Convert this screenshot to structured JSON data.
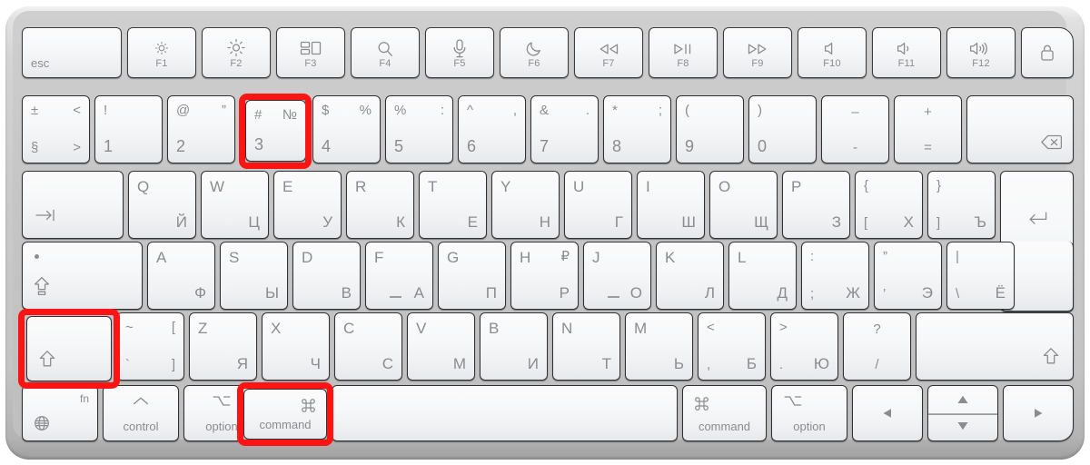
{
  "device": {
    "name": "Apple Magic Keyboard with Touch ID",
    "layout": "US / Russian (Cyrillic) dual-legend",
    "accent_highlight_color": "#ff1414",
    "body_color": "#c8c8c8",
    "key_color": "#f6f7f9",
    "legend_color": "#8a8c90"
  },
  "highlighted_keys": [
    "shift-left",
    "3",
    "command-left"
  ],
  "rows": {
    "function_row": [
      {
        "id": "esc",
        "label": "esc",
        "type": "word"
      },
      {
        "id": "f1",
        "fkey": "F1",
        "icon": "brightness-down-icon"
      },
      {
        "id": "f2",
        "fkey": "F2",
        "icon": "brightness-up-icon"
      },
      {
        "id": "f3",
        "fkey": "F3",
        "icon": "mission-control-icon"
      },
      {
        "id": "f4",
        "fkey": "F4",
        "icon": "spotlight-search-icon"
      },
      {
        "id": "f5",
        "fkey": "F5",
        "icon": "dictation-microphone-icon"
      },
      {
        "id": "f6",
        "fkey": "F6",
        "icon": "do-not-disturb-moon-icon"
      },
      {
        "id": "f7",
        "fkey": "F7",
        "icon": "rewind-icon"
      },
      {
        "id": "f8",
        "fkey": "F8",
        "icon": "play-pause-icon"
      },
      {
        "id": "f9",
        "fkey": "F9",
        "icon": "fast-forward-icon"
      },
      {
        "id": "f10",
        "fkey": "F10",
        "icon": "mute-icon"
      },
      {
        "id": "f11",
        "fkey": "F11",
        "icon": "volume-down-icon"
      },
      {
        "id": "f12",
        "fkey": "F12",
        "icon": "volume-up-icon"
      },
      {
        "id": "touchid",
        "icon": "touch-id-lock-icon"
      }
    ],
    "number_row": [
      {
        "id": "section",
        "top_left": "±",
        "top_right": "<",
        "bottom_left": "§",
        "bottom_right": ">"
      },
      {
        "id": "1",
        "top_left": "!",
        "bottom_left": "1"
      },
      {
        "id": "2",
        "top_left": "@",
        "top_right": "”",
        "bottom_left": "2"
      },
      {
        "id": "3",
        "top_left": "#",
        "top_right": "№",
        "bottom_left": "3",
        "highlighted": true
      },
      {
        "id": "4",
        "top_left": "$",
        "top_right": "%",
        "bottom_left": "4"
      },
      {
        "id": "5",
        "top_left": "%",
        "top_right": ":",
        "bottom_left": "5"
      },
      {
        "id": "6",
        "top_left": "^",
        "top_right": ",",
        "bottom_left": "6"
      },
      {
        "id": "7",
        "top_left": "&",
        "top_right": ".",
        "bottom_left": "7"
      },
      {
        "id": "8",
        "top_left": "*",
        "top_right": ";",
        "bottom_left": "8"
      },
      {
        "id": "9",
        "top_left": "(",
        "bottom_left": "9"
      },
      {
        "id": "0",
        "top_left": ")",
        "bottom_left": "0"
      },
      {
        "id": "minus",
        "top_left": "–",
        "bottom_left": "-"
      },
      {
        "id": "equal",
        "top_left": "+",
        "bottom_left": "="
      },
      {
        "id": "delete",
        "icon": "delete-backspace-icon"
      }
    ],
    "qwerty_row": [
      {
        "id": "tab",
        "icon": "tab-arrow-icon"
      },
      {
        "id": "q",
        "latin": "Q",
        "cyrillic": "Й"
      },
      {
        "id": "w",
        "latin": "W",
        "cyrillic": "Ц"
      },
      {
        "id": "e",
        "latin": "E",
        "cyrillic": "У"
      },
      {
        "id": "r",
        "latin": "R",
        "cyrillic": "К"
      },
      {
        "id": "t",
        "latin": "T",
        "cyrillic": "Е"
      },
      {
        "id": "y",
        "latin": "Y",
        "cyrillic": "Н"
      },
      {
        "id": "u",
        "latin": "U",
        "cyrillic": "Г"
      },
      {
        "id": "i",
        "latin": "I",
        "cyrillic": "Ш"
      },
      {
        "id": "o",
        "latin": "O",
        "cyrillic": "Щ"
      },
      {
        "id": "p",
        "latin": "P",
        "cyrillic": "З"
      },
      {
        "id": "bracket-left",
        "top_left": "{",
        "bottom_left": "[",
        "bottom_right": "Х"
      },
      {
        "id": "bracket-right",
        "top_left": "}",
        "bottom_left": "]",
        "bottom_right": "Ъ"
      },
      {
        "id": "return",
        "icon": "return-enter-icon"
      }
    ],
    "home_row": [
      {
        "id": "capslock",
        "icon": "caps-lock-icon",
        "indicator": true
      },
      {
        "id": "a",
        "latin": "A",
        "cyrillic": "Ф"
      },
      {
        "id": "s",
        "latin": "S",
        "cyrillic": "Ы"
      },
      {
        "id": "d",
        "latin": "D",
        "cyrillic": "В"
      },
      {
        "id": "f",
        "latin": "F",
        "cyrillic": "А",
        "underscore": true
      },
      {
        "id": "g",
        "latin": "G",
        "cyrillic": "П"
      },
      {
        "id": "h",
        "latin": "H",
        "latin_right": "₽",
        "cyrillic": "Р"
      },
      {
        "id": "j",
        "latin": "J",
        "cyrillic": "О",
        "underscore": true
      },
      {
        "id": "k",
        "latin": "K",
        "cyrillic": "Л"
      },
      {
        "id": "l",
        "latin": "L",
        "cyrillic": "Д"
      },
      {
        "id": "semicolon",
        "top_left": ":",
        "bottom_left": ";",
        "bottom_right": "Ж"
      },
      {
        "id": "quote",
        "top_left": "”",
        "bottom_left": "’",
        "bottom_right": "Э"
      },
      {
        "id": "backslash",
        "top_left": "|",
        "bottom_left": "\\",
        "bottom_right": "Ё"
      }
    ],
    "shift_row": [
      {
        "id": "shift-left",
        "icon": "shift-arrow-icon",
        "highlighted": true
      },
      {
        "id": "grave",
        "top_left": "~",
        "top_right": "[",
        "bottom_left": "`",
        "bottom_right": "]"
      },
      {
        "id": "z",
        "latin": "Z",
        "cyrillic": "Я"
      },
      {
        "id": "x",
        "latin": "X",
        "cyrillic": "Ч"
      },
      {
        "id": "c",
        "latin": "C",
        "cyrillic": "С"
      },
      {
        "id": "v",
        "latin": "V",
        "cyrillic": "М"
      },
      {
        "id": "b",
        "latin": "B",
        "cyrillic": "И"
      },
      {
        "id": "n",
        "latin": "N",
        "cyrillic": "Т"
      },
      {
        "id": "m",
        "latin": "M",
        "cyrillic": "Ь"
      },
      {
        "id": "comma",
        "top_left": "<",
        "bottom_left": ",",
        "bottom_right": "Б"
      },
      {
        "id": "period",
        "top_left": ">",
        "bottom_left": ".",
        "bottom_right": "Ю"
      },
      {
        "id": "slash",
        "top_left": "?",
        "bottom_left": "/"
      },
      {
        "id": "shift-right",
        "icon": "shift-arrow-icon"
      }
    ],
    "bottom_row": [
      {
        "id": "fn",
        "label": "fn",
        "icon": "globe-icon"
      },
      {
        "id": "control-left",
        "label": "control",
        "icon": "control-caret-icon"
      },
      {
        "id": "option-left",
        "label": "option",
        "icon": "option-alt-icon"
      },
      {
        "id": "command-left",
        "label": "command",
        "icon": "command-loop-icon",
        "highlighted": true
      },
      {
        "id": "space"
      },
      {
        "id": "command-right",
        "label": "command",
        "icon": "command-loop-icon"
      },
      {
        "id": "option-right",
        "label": "option",
        "icon": "option-alt-icon"
      },
      {
        "id": "arrow-left",
        "icon": "arrow-left-icon"
      },
      {
        "id": "arrow-up",
        "icon": "arrow-up-icon"
      },
      {
        "id": "arrow-down",
        "icon": "arrow-down-icon"
      },
      {
        "id": "arrow-right",
        "icon": "arrow-right-icon"
      }
    ]
  }
}
